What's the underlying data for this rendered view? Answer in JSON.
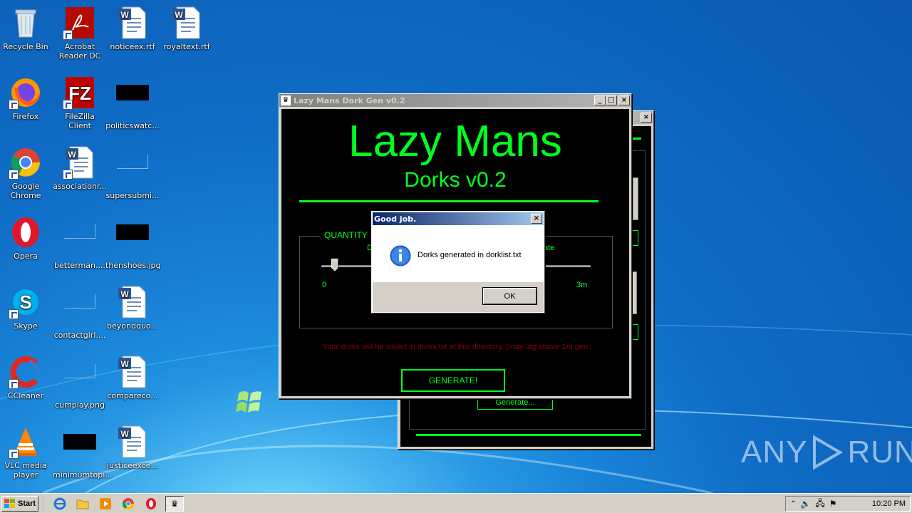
{
  "desktop": {
    "icons": [
      {
        "label": "Recycle Bin",
        "icon": "recycle-bin-icon"
      },
      {
        "label": "Acrobat Reader DC",
        "icon": "acrobat-icon"
      },
      {
        "label": "noticeex.rtf",
        "icon": "word-document-icon"
      },
      {
        "label": "royaltext.rtf",
        "icon": "word-document-icon"
      },
      {
        "label": "Firefox",
        "icon": "firefox-icon"
      },
      {
        "label": "FileZilla Client",
        "icon": "filezilla-icon"
      },
      {
        "label": "politicswatc...",
        "icon": "black-file-icon"
      },
      {
        "label": "Google Chrome",
        "icon": "chrome-icon"
      },
      {
        "label": "associationr...",
        "icon": "word-document-icon"
      },
      {
        "label": "supersubmi...",
        "icon": "blank-file-icon"
      },
      {
        "label": "Opera",
        "icon": "opera-icon"
      },
      {
        "label": "betterman....",
        "icon": "blank-file-icon"
      },
      {
        "label": "thenshoes.jpg",
        "icon": "black-file-icon"
      },
      {
        "label": "Skype",
        "icon": "skype-icon"
      },
      {
        "label": "contactgirl....",
        "icon": "blank-file-icon"
      },
      {
        "label": "beyondquo...",
        "icon": "word-document-icon"
      },
      {
        "label": "CCleaner",
        "icon": "ccleaner-icon"
      },
      {
        "label": "cumplay.png",
        "icon": "blank-file-icon"
      },
      {
        "label": "compareco...",
        "icon": "word-document-icon"
      },
      {
        "label": "VLC media player",
        "icon": "vlc-icon"
      },
      {
        "label": "minimumtopi...",
        "icon": "black-file-icon"
      },
      {
        "label": "justiceexce...",
        "icon": "word-document-icon"
      }
    ]
  },
  "back_window": {
    "generate_label": "Generate..."
  },
  "main_window": {
    "title": "Lazy Mans Dork Gen v0.2",
    "heading": "Lazy Mans",
    "subheading": "Dorks v0.2",
    "quantity_label": "QUANTITY",
    "partial_left": "D",
    "partial_right": "ate",
    "slider_min": "0",
    "slider_max": "3m",
    "slider_value_fraction": 0.05,
    "save_note": "Your dorks will be saved in dorks.txt at this directory. (may lag above 1m gen",
    "generate_button": "GENERATE!"
  },
  "dialog": {
    "title": "Good job.",
    "message": "Dorks generated in dorklist.txt",
    "ok_button": "OK"
  },
  "taskbar": {
    "start_label": "Start",
    "clock": "10:20 PM"
  },
  "watermark": {
    "left": "ANY",
    "right": "RUN"
  },
  "colors": {
    "terminal_green": "#00ff1e",
    "note_red": "#8b0000"
  }
}
